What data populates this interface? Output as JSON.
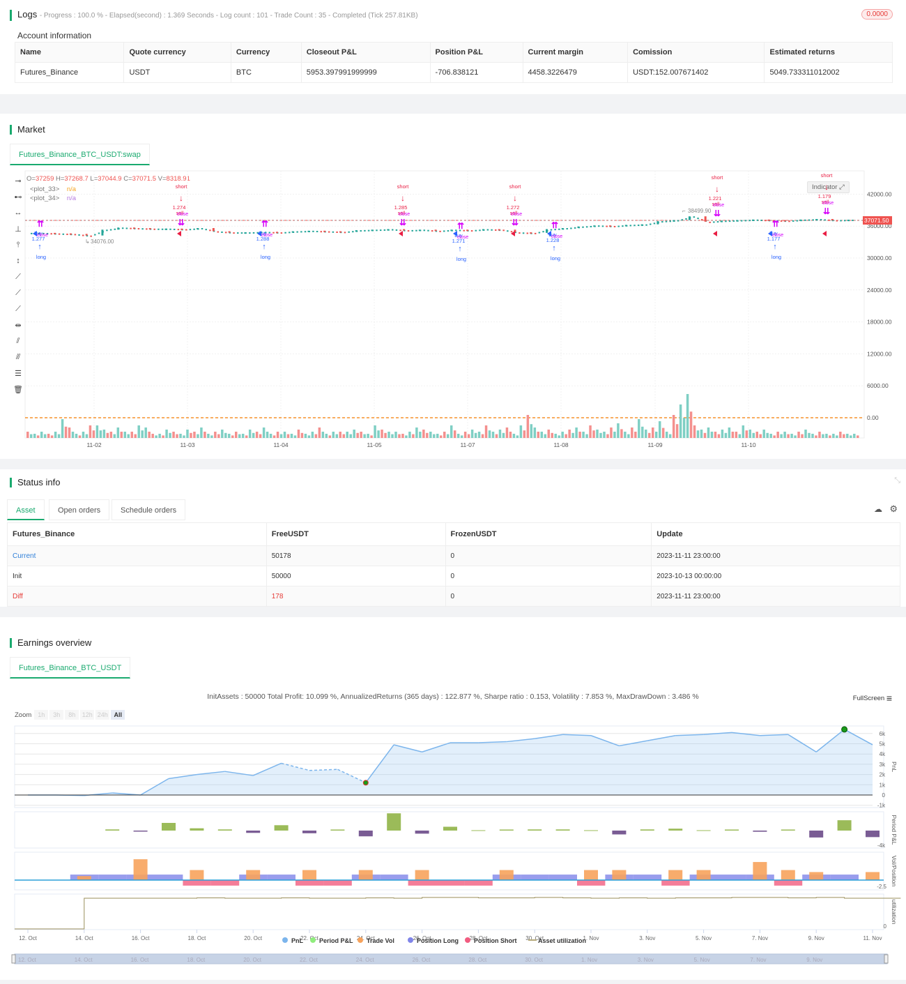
{
  "logs": {
    "title": "Logs",
    "summary": "- Progress : 100.0 % - Elapsed(second) : 1.369  Seconds - Log count : 101 - Trade Count : 35 - Completed (Tick 257.81KB)",
    "badge": "0.0000"
  },
  "account": {
    "title": "Account information",
    "columns": [
      "Name",
      "Quote currency",
      "Currency",
      "Closeout P&L",
      "Position P&L",
      "Current margin",
      "Comission",
      "Estimated returns"
    ],
    "row": [
      "Futures_Binance",
      "USDT",
      "BTC",
      "5953.397991999999",
      "-706.838121",
      "4458.3226479",
      "USDT:152.007671402",
      "5049.733311012002"
    ]
  },
  "market": {
    "title": "Market",
    "tab": "Futures_Binance_BTC_USDT:swap",
    "indicator_button": "Indicator",
    "ohlc": {
      "o_label": "O=",
      "o": "37259",
      "h_label": " H=",
      "h": "37268.7",
      "l_label": " L=",
      "l": "37044.9",
      "c_label": " C=",
      "c": "37071.5",
      "v_label": " V=",
      "v": "8318.91"
    },
    "plots": [
      {
        "name": "<plot_33>",
        "value": "n/a",
        "color": "#f5a623"
      },
      {
        "name": "<plot_34>",
        "value": "n/a",
        "color": "#b57be0"
      }
    ],
    "toolbar_icons": [
      "horizontal-line-icon",
      "horizontal-ray-icon",
      "horizontal-segment-icon",
      "vertical-line-icon",
      "vertical-ray-icon",
      "vertical-segment-icon",
      "trend-line-icon",
      "ray-line-icon",
      "extended-line-icon",
      "price-range-icon",
      "parallel-channel-icon",
      "pitchfork-icon",
      "fib-retracement-icon",
      "trash-icon"
    ]
  },
  "chart_data": [
    {
      "type": "candlestick",
      "price_ticks": [
        "42000.00",
        "36000.00",
        "30000.00",
        "24000.00",
        "18000.00",
        "12000.00",
        "6000.00",
        "0.00"
      ],
      "ylim": [
        0,
        44000
      ],
      "last_price": "37071.50",
      "x_ticks": [
        "11-02",
        "11-03",
        "11-04",
        "11-05",
        "11-07",
        "11-08",
        "11-09",
        "11-10"
      ],
      "closes": [
        34600,
        34500,
        34400,
        34100,
        35200,
        35600,
        35500,
        35400,
        35400,
        35300,
        35500,
        34900,
        34700,
        34700,
        34800,
        34700,
        34900,
        35000,
        34900,
        34800,
        35100,
        35200,
        35300,
        35100,
        35200,
        35000,
        35200,
        35100,
        35300,
        35200,
        34700,
        34600,
        35300,
        35500,
        35800,
        36000,
        35900,
        36100,
        36200,
        36800,
        37000,
        37700,
        36700,
        36900,
        37000,
        37100,
        37000,
        36900,
        37100,
        37200,
        37000,
        37071.5
      ],
      "volumes": [
        3,
        2,
        3,
        2,
        3,
        9,
        5,
        2,
        3,
        6,
        6,
        4,
        3,
        5,
        3,
        3,
        6,
        5,
        2,
        2,
        4,
        3,
        2,
        4,
        3,
        5,
        2,
        3,
        4,
        2,
        3,
        2,
        4,
        3,
        5,
        2,
        3,
        3,
        2,
        4,
        2,
        3,
        5,
        2,
        3,
        3,
        3,
        4,
        3,
        2,
        6,
        4,
        3,
        3,
        2,
        3,
        5,
        4,
        3,
        2,
        3,
        6,
        2,
        3,
        4,
        3,
        6,
        3,
        4,
        5,
        2,
        6,
        11,
        5,
        3,
        4,
        2,
        3,
        4,
        5,
        3,
        6,
        4,
        3,
        5,
        7,
        3,
        5,
        9,
        4,
        5,
        8,
        3,
        11,
        16,
        21,
        6,
        4,
        5,
        3,
        4,
        5,
        3,
        6,
        4,
        3,
        4,
        2,
        3,
        3,
        2,
        3,
        4,
        2,
        3,
        2,
        2,
        3,
        2,
        2
      ],
      "annotations": [
        {
          "text": "34076.00"
        },
        {
          "text": "38499.90"
        }
      ],
      "signals": [
        {
          "side": "long",
          "label": "long",
          "ratio": "1.277",
          "action": "buy",
          "close": "close"
        },
        {
          "side": "short",
          "label": "short",
          "ratio": "1.274",
          "action": "sell",
          "close": "close"
        },
        {
          "side": "long",
          "label": "long",
          "ratio": "1.288",
          "action": "buy",
          "close": "close"
        },
        {
          "side": "short",
          "label": "short",
          "ratio": "1.285",
          "action": "sell",
          "close": "close"
        },
        {
          "side": "long",
          "label": "long",
          "ratio": "1.271",
          "action": "buy",
          "close": "close"
        },
        {
          "side": "short",
          "label": "short",
          "ratio": "1.272",
          "action": "sell",
          "close": "close"
        },
        {
          "side": "long",
          "label": "long",
          "ratio": "1.228",
          "action": "buy",
          "close": "close"
        },
        {
          "side": "short",
          "label": "short",
          "ratio": "1.221",
          "action": "sell",
          "close": "close"
        },
        {
          "side": "long",
          "label": "long",
          "ratio": "1.177",
          "action": "buy",
          "close": "close"
        },
        {
          "side": "short",
          "label": "short",
          "ratio": "1.179",
          "action": "sell",
          "close": "close"
        }
      ],
      "colors": {
        "up": "#26a69a",
        "down": "#ef5350",
        "long": "#2962ff",
        "short": "#e91e43",
        "close": "#d500f9",
        "zero_line": "#f57c00"
      }
    },
    {
      "type": "line",
      "title": "InitAssets : 50000 Total Profit: 10.099 %, AnnualizedReturns (365 days) : 122.877 %, Sharpe ratio : 0.153, Volatility : 7.853 %, MaxDrawDown : 3.486 %",
      "x_ticks": [
        "12. Oct",
        "14. Oct",
        "16. Oct",
        "18. Oct",
        "20. Oct",
        "22. Oct",
        "24. Oct",
        "26. Oct",
        "28. Oct",
        "30. Oct",
        "1. Nov",
        "3. Nov",
        "5. Nov",
        "7. Nov",
        "9. Nov",
        "11. Nov"
      ],
      "dates_start": "2023-10-12",
      "dates_end": "2023-11-11",
      "pnl_ticks": [
        "6k",
        "5k",
        "4k",
        "3k",
        "2k",
        "1k",
        "0",
        "-1k"
      ],
      "pnl": [
        0,
        0,
        -0.05,
        0.2,
        0,
        1.6,
        2.0,
        2.3,
        1.9,
        3.1,
        2.4,
        2.5,
        1.2,
        4.9,
        4.2,
        5.1,
        5.1,
        5.2,
        5.5,
        5.9,
        5.8,
        4.8,
        5.3,
        5.8,
        5.9,
        6.1,
        5.8,
        5.9,
        4.2,
        6.4,
        4.9
      ],
      "period_pnl_tick": "-4k",
      "period_pnl": [
        0,
        0,
        0,
        0.3,
        -0.2,
        2,
        0.6,
        0.3,
        -0.6,
        1.4,
        -0.7,
        0.1,
        -1.5,
        4.5,
        -0.8,
        1,
        0,
        0.1,
        0.3,
        0.3,
        0,
        -1,
        0.3,
        0.5,
        0,
        0.1,
        -0.3,
        0.1,
        -1.8,
        2.7,
        -1.7
      ],
      "vol_tick": "-2.5",
      "trade_vol": [
        0,
        0,
        1.6,
        0,
        8.3,
        0,
        4,
        0,
        4,
        0,
        4,
        0,
        4,
        0,
        4,
        0,
        0,
        4,
        0,
        0,
        4,
        4,
        0,
        4,
        4,
        0,
        7.2,
        4,
        3.2,
        0,
        3.2
      ],
      "position": [
        0,
        0,
        2.2,
        2.2,
        2.2,
        2.2,
        -2.2,
        -2.2,
        2.2,
        2.2,
        -2.2,
        -2.2,
        2.2,
        2.2,
        -2.2,
        -2.2,
        -2.2,
        2.2,
        2.2,
        2.2,
        -2.2,
        2.2,
        2.2,
        -2.2,
        2.2,
        2.2,
        2.2,
        -2.2,
        2.2,
        2.2,
        0
      ],
      "util_tick": "0",
      "utilization": [
        0,
        0,
        0.8,
        0.8,
        0.8,
        0.8,
        0.81,
        0.8,
        0.8,
        0.81,
        0.8,
        0.8,
        0.81,
        0.8,
        0.82,
        0.82,
        0.81,
        0.81,
        0.82,
        0.81,
        0.8,
        0.81,
        0.8,
        0.81,
        0.81,
        0.82,
        0.82,
        0.81,
        0.82,
        0.8,
        0.8
      ],
      "axis_titles": [
        "PnL",
        "Period P&L",
        "Vol/Position",
        "utilization"
      ],
      "legend": [
        {
          "name": "PnL",
          "color": "#7cb5ec"
        },
        {
          "name": "Period P&L",
          "color": "#90ed7d"
        },
        {
          "name": "Trade Vol",
          "color": "#f7a35c"
        },
        {
          "name": "Position Long",
          "color": "#8085e9"
        },
        {
          "name": "Position Short",
          "color": "#f15c80"
        },
        {
          "name": "Asset utilization",
          "color": "#b5a97a"
        }
      ],
      "legend_position": "bottom-center",
      "navigator_ticks": [
        "12. Oct",
        "14. Oct",
        "16. Oct",
        "18. Oct",
        "20. Oct",
        "22. Oct",
        "24. Oct",
        "26. Oct",
        "28. Oct",
        "30. Oct",
        "1. Nov",
        "3. Nov",
        "5. Nov",
        "7. Nov",
        "9. Nov"
      ]
    }
  ],
  "status": {
    "title": "Status info",
    "tabs": [
      "Asset",
      "Open orders",
      "Schedule orders"
    ],
    "columns": [
      "Futures_Binance",
      "FreeUSDT",
      "FrozenUSDT",
      "Update"
    ],
    "rows": [
      [
        "Current",
        "50178",
        "0",
        "2023-11-11 23:00:00"
      ],
      [
        "Init",
        "50000",
        "0",
        "2023-10-13 00:00:00"
      ],
      [
        "Diff",
        "178",
        "0",
        "2023-11-11 23:00:00"
      ]
    ]
  },
  "earnings": {
    "title": "Earnings overview",
    "tab": "Futures_Binance_BTC_USDT",
    "fullscreen": "FullScreen",
    "zoom_label": "Zoom",
    "zoom_options": [
      "1h",
      "3h",
      "8h",
      "12h",
      "24h",
      "All"
    ]
  }
}
